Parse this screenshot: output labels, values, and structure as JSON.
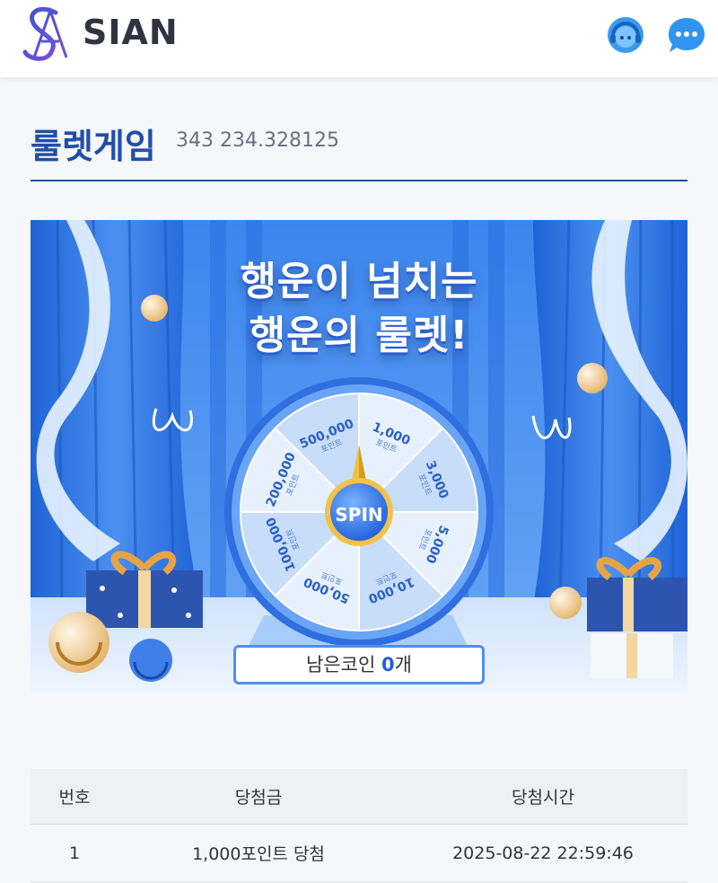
{
  "header": {
    "brand": "SIAN",
    "icons": [
      "logo-mark",
      "support-headset-icon",
      "chat-bubble-icon"
    ]
  },
  "page": {
    "title": "룰렛게임",
    "subtitle": "343 234.328125"
  },
  "banner": {
    "headline_line1": "행운이 넘치는",
    "headline_line2": "행운의 룰렛!",
    "spin_label": "SPIN",
    "segments": [
      {
        "amount": "1,000",
        "unit": "포인트"
      },
      {
        "amount": "3,000",
        "unit": "포인트"
      },
      {
        "amount": "5,000",
        "unit": "포인트"
      },
      {
        "amount": "10,000",
        "unit": "포인트"
      },
      {
        "amount": "50,000",
        "unit": "포인트"
      },
      {
        "amount": "100,000",
        "unit": "포인트"
      },
      {
        "amount": "200,000",
        "unit": "포인트"
      },
      {
        "amount": "500,000",
        "unit": "포인트"
      }
    ],
    "coins_label": "남은코인",
    "coins_value": "0",
    "coins_suffix": "개"
  },
  "table": {
    "headers": [
      "번호",
      "당첨금",
      "당첨시간"
    ],
    "rows": [
      [
        "1",
        "1,000포인트 당첨",
        "2025-08-22 22:59:46"
      ]
    ]
  },
  "colors": {
    "accent": "#1f4fa8",
    "banner_blue": "#3f86ee",
    "coin_value": "#1f5fd8"
  }
}
